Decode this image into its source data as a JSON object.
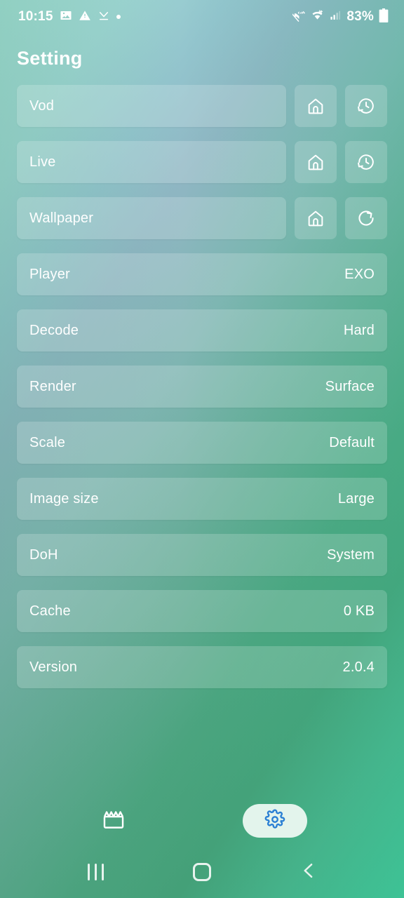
{
  "statusbar": {
    "time": "10:15",
    "battery_percent": "83%",
    "left_icons": [
      "image-icon",
      "warning-triangle-icon",
      "download-complete-icon",
      "dot-indicator-icon"
    ],
    "right_icons": [
      "mute-icon",
      "wifi-data-icon",
      "signal-bars-icon",
      "battery-icon"
    ]
  },
  "header": {
    "title": "Setting"
  },
  "settings": {
    "rows": [
      {
        "label": "Vod",
        "value": "",
        "buttons": [
          "home-icon",
          "history-icon"
        ]
      },
      {
        "label": "Live",
        "value": "",
        "buttons": [
          "home-icon",
          "history-icon"
        ]
      },
      {
        "label": "Wallpaper",
        "value": "",
        "buttons": [
          "home-icon",
          "refresh-icon"
        ]
      },
      {
        "label": "Player",
        "value": "EXO",
        "buttons": []
      },
      {
        "label": "Decode",
        "value": "Hard",
        "buttons": []
      },
      {
        "label": "Render",
        "value": "Surface",
        "buttons": []
      },
      {
        "label": "Scale",
        "value": "Default",
        "buttons": []
      },
      {
        "label": "Image size",
        "value": "Large",
        "buttons": []
      },
      {
        "label": "DoH",
        "value": "System",
        "buttons": []
      },
      {
        "label": "Cache",
        "value": "0 KB",
        "buttons": []
      },
      {
        "label": "Version",
        "value": "2.0.4",
        "buttons": []
      }
    ]
  },
  "bottom_nav": {
    "items": [
      {
        "name": "vod-tab",
        "icon": "clapperboard-icon",
        "active": false
      },
      {
        "name": "settings-tab",
        "icon": "gear-icon",
        "active": true
      }
    ],
    "active_pill_color": "#e3f4ec",
    "active_icon_color": "#2a7fd4"
  },
  "system_nav": {
    "items": [
      {
        "name": "recents-button",
        "icon": "recents-icon"
      },
      {
        "name": "home-button",
        "icon": "home-square-icon"
      },
      {
        "name": "back-button",
        "icon": "chevron-left-icon"
      }
    ]
  },
  "colors": {
    "row_fill": "rgba(255,255,255,0.18)",
    "text": "#ffffff",
    "gradient_top_left": "#a6e0d8",
    "gradient_top_right": "#8fb6c3",
    "gradient_bottom_left": "#46a079",
    "gradient_bottom_right": "#3ec194"
  }
}
